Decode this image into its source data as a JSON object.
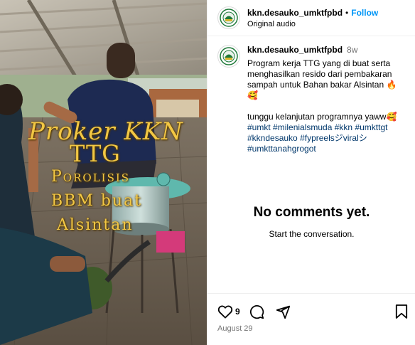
{
  "post": {
    "media": {
      "overlay_lines": [
        "Proker KKN",
        "TTG",
        "Porolisis",
        "BBM buat",
        "Alsintan"
      ]
    },
    "header": {
      "username": "kkn.desauko_umktfpbd",
      "separator": "•",
      "follow_label": "Follow",
      "audio_label": "Original audio",
      "avatar_icon": "organization-logo-icon"
    },
    "caption": {
      "username": "kkn.desauko_umktfpbd",
      "time": "8w",
      "text": "Program kerja TTG yang di buat serta menghasilkan resido dari pembakaran sampah untuk Bahan bakar Alsintan 🔥🥰",
      "text2": "tunggu kelanjutan programnya yaww🥰",
      "hashtags": [
        "#umkt",
        "#milenialsmuda",
        "#kkn",
        "#umkttgt",
        "#kkndesauko",
        "#fypreels",
        "ジviralシ",
        "#umkttanahgrogot"
      ]
    },
    "comments": {
      "empty_title": "No comments yet.",
      "empty_subtitle": "Start the conversation."
    },
    "actions": {
      "like_icon": "heart-icon",
      "like_count": "9",
      "comment_icon": "comment-icon",
      "share_icon": "share-icon",
      "save_icon": "bookmark-icon",
      "date": "August 29"
    },
    "colors": {
      "link": "#0095f6",
      "hashtag": "#00376b",
      "overlay_text": "#f2c744",
      "muted": "#737373"
    }
  }
}
